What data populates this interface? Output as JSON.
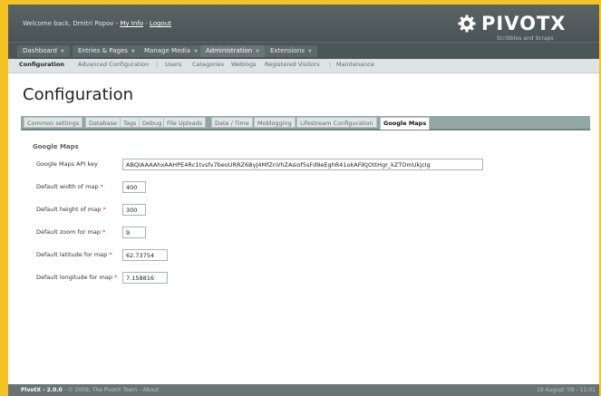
{
  "header": {
    "welcome_text": "Welcome back, Dmitri Popov -",
    "my_info_link": "My Info",
    "separator": "-",
    "logout_link": "Logout",
    "logo_text": "PIVOTX",
    "tagline": "Scribbles and Scraps"
  },
  "mainnav": [
    {
      "label": "Dashboard"
    },
    {
      "label": "Entries & Pages"
    },
    {
      "label": "Manage Media"
    },
    {
      "label": "Administration"
    },
    {
      "label": "Extensions"
    }
  ],
  "subnav": [
    {
      "label": "Configuration"
    },
    {
      "label": "Advanced Configuration"
    },
    {
      "label": "Users"
    },
    {
      "label": "Categories"
    },
    {
      "label": "Weblogs"
    },
    {
      "label": "Registered Visitors"
    },
    {
      "label": "Maintenance"
    }
  ],
  "page_title": "Configuration",
  "tabs": [
    {
      "label": "Common settings"
    },
    {
      "label": "Database"
    },
    {
      "label": "Tags"
    },
    {
      "label": "Debug"
    },
    {
      "label": "File Uploads"
    },
    {
      "label": "Date / Time"
    },
    {
      "label": "Moblogging"
    },
    {
      "label": "Lifestream Configuration"
    },
    {
      "label": "Google Maps"
    }
  ],
  "form": {
    "section_title": "Google Maps",
    "required_mark": "*",
    "fields": [
      {
        "label": "Google Maps API key",
        "value": "ABQIAAAAhxAAHPE4Rc1tvsfv7beoURRZ6ByJ4MfZnVhZAsiof5sFd9eEghR41okAFiKJOttHgr_kZTOmUkjcIg",
        "required": false
      },
      {
        "label": "Default width of map",
        "value": "400",
        "required": true
      },
      {
        "label": "Default height of map",
        "value": "300",
        "required": true
      },
      {
        "label": "Default zoom for map",
        "value": "9",
        "required": true
      },
      {
        "label": "Default latitude for map",
        "value": "62.73754",
        "required": true
      },
      {
        "label": "Default longitude for map",
        "value": "7.158816",
        "required": true
      }
    ]
  },
  "footer": {
    "version": "PivotX - 2.0.0",
    "copyright": "© 2009, The PivotX Team",
    "about": "About",
    "sep": "-",
    "date": "19 August '09 - 11:01"
  },
  "colors": {
    "background": "#f6c324",
    "header": "#4a5355",
    "tabbar": "#93a6a6",
    "required": "#d12a2a"
  }
}
